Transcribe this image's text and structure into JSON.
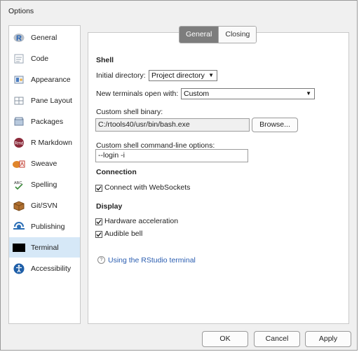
{
  "window": {
    "title": "Options"
  },
  "sidebar": {
    "items": [
      {
        "label": "General",
        "icon": "r-logo-icon"
      },
      {
        "label": "Code",
        "icon": "code-icon"
      },
      {
        "label": "Appearance",
        "icon": "appearance-icon"
      },
      {
        "label": "Pane Layout",
        "icon": "pane-layout-icon"
      },
      {
        "label": "Packages",
        "icon": "packages-icon"
      },
      {
        "label": "R Markdown",
        "icon": "rmarkdown-icon"
      },
      {
        "label": "Sweave",
        "icon": "sweave-icon"
      },
      {
        "label": "Spelling",
        "icon": "spelling-icon"
      },
      {
        "label": "Git/SVN",
        "icon": "git-svn-icon"
      },
      {
        "label": "Publishing",
        "icon": "publishing-icon"
      },
      {
        "label": "Terminal",
        "icon": "terminal-icon"
      },
      {
        "label": "Accessibility",
        "icon": "accessibility-icon"
      }
    ],
    "selected": "Terminal"
  },
  "tabs": [
    {
      "label": "General"
    },
    {
      "label": "Closing"
    }
  ],
  "shell": {
    "heading": "Shell",
    "initial_directory_label": "Initial directory:",
    "initial_directory_value": "Project directory",
    "new_terminals_label": "New terminals open with:",
    "new_terminals_value": "Custom",
    "custom_binary_label": "Custom shell binary:",
    "custom_binary_value": "C:/rtools40/usr/bin/bash.exe",
    "browse_label": "Browse...",
    "cmdline_label": "Custom shell command-line options:",
    "cmdline_value": "--login -i"
  },
  "connection": {
    "heading": "Connection",
    "websockets_label": "Connect with WebSockets",
    "websockets_checked": true
  },
  "display": {
    "heading": "Display",
    "hw_accel_label": "Hardware acceleration",
    "hw_accel_checked": true,
    "audible_bell_label": "Audible bell",
    "audible_bell_checked": true
  },
  "help_link": {
    "text": "Using the RStudio terminal",
    "icon": "help-icon"
  },
  "footer": {
    "ok_label": "OK",
    "cancel_label": "Cancel",
    "apply_label": "Apply"
  },
  "colors": {
    "selection": "#d6e8f7",
    "active_tab": "#7d7d7d",
    "link": "#2a5db0"
  }
}
